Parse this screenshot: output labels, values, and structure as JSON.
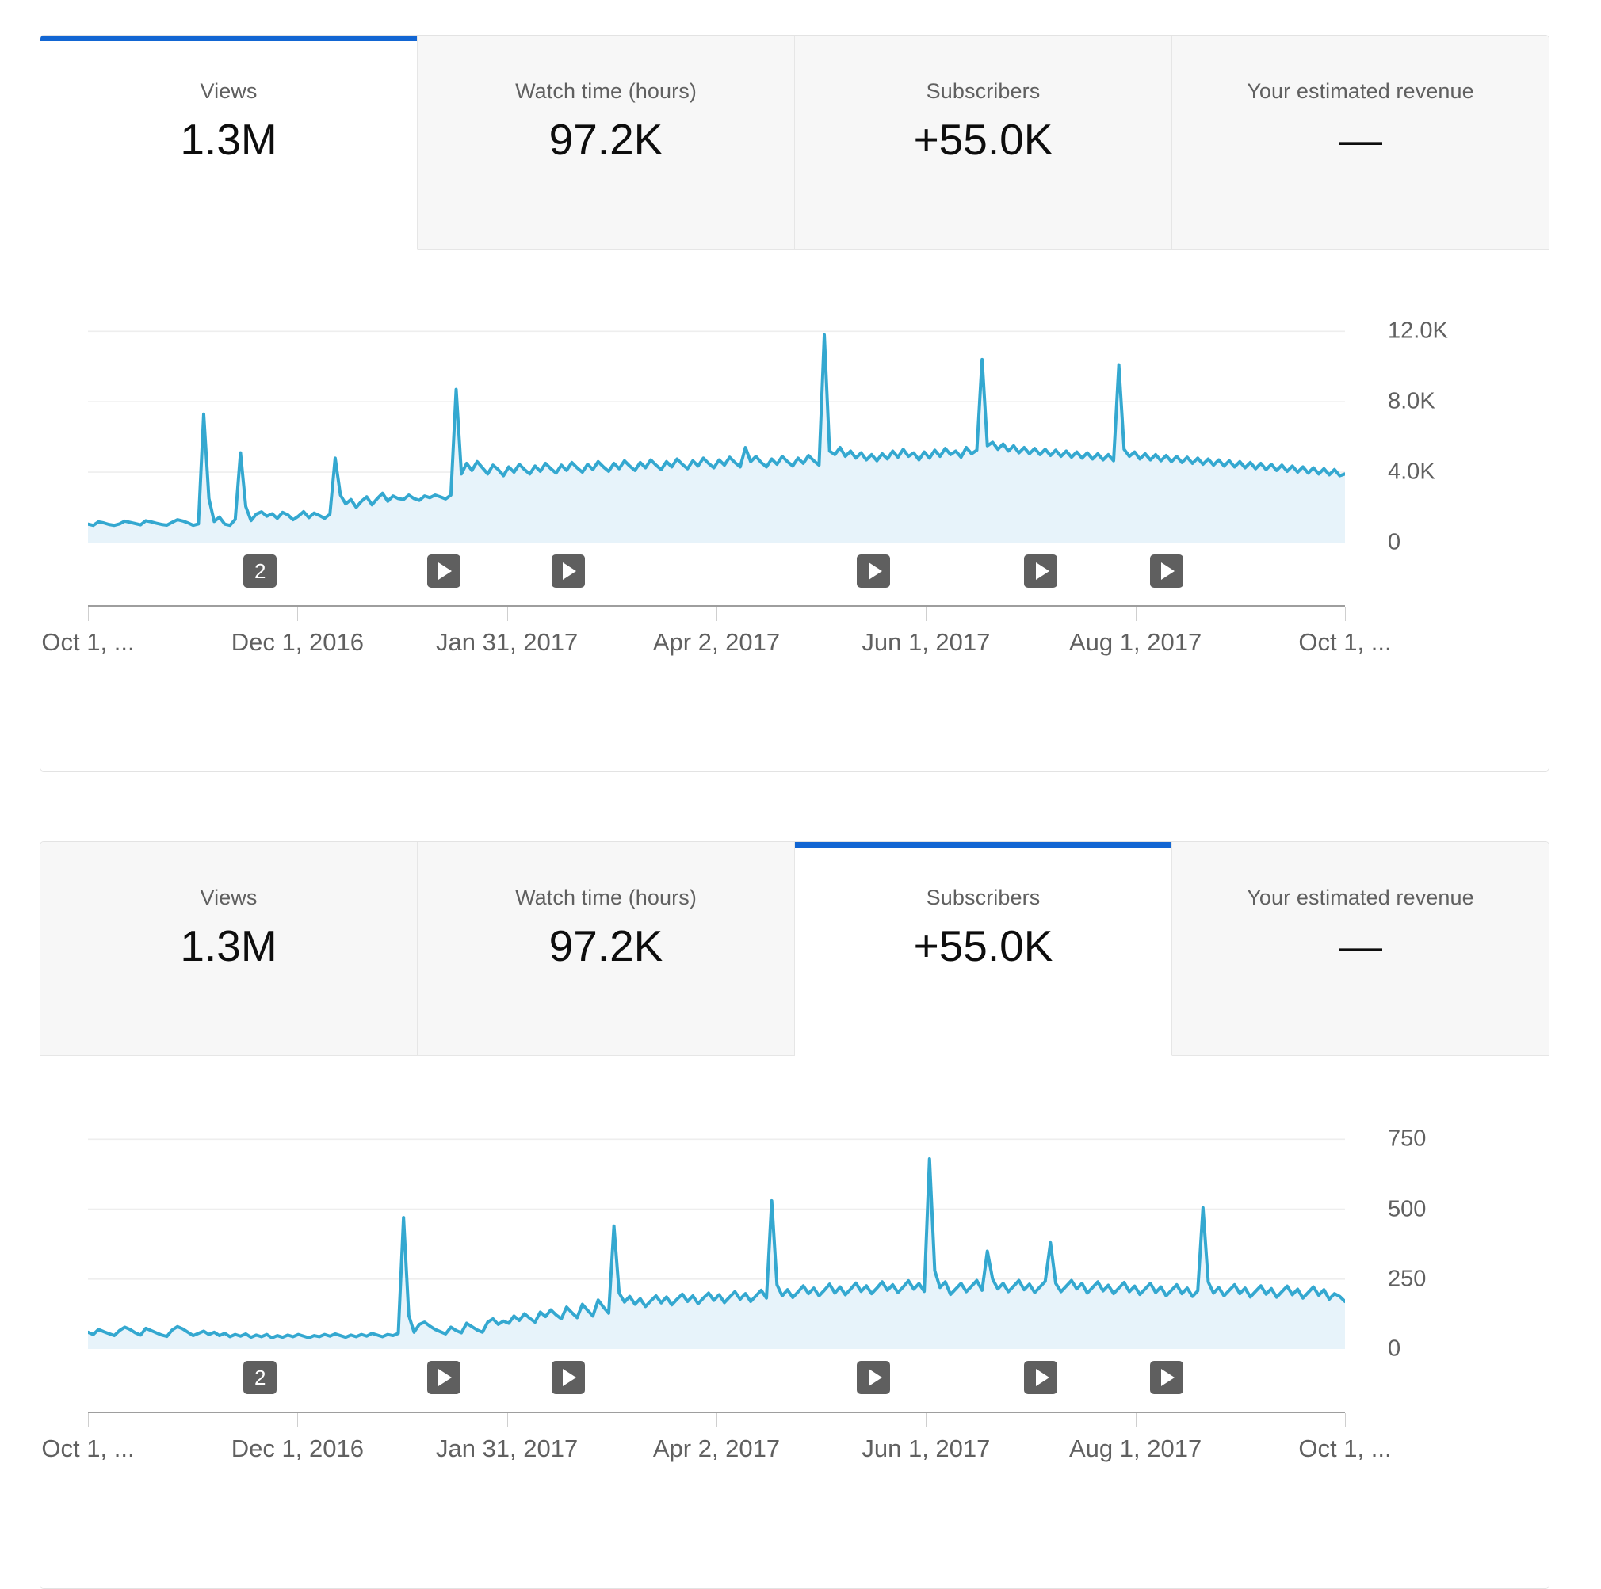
{
  "panels": [
    {
      "name": "views-panel",
      "active_tab_index": 0,
      "tabs": [
        {
          "label": "Views",
          "value": "1.3M",
          "key": "views"
        },
        {
          "label": "Watch time (hours)",
          "value": "97.2K",
          "key": "watch-time"
        },
        {
          "label": "Subscribers",
          "value": "+55.0K",
          "key": "subscribers"
        },
        {
          "label": "Your estimated revenue",
          "value": "—",
          "key": "estimated-revenue"
        }
      ],
      "chart_ref": 0
    },
    {
      "name": "subscribers-panel",
      "active_tab_index": 2,
      "tabs": [
        {
          "label": "Views",
          "value": "1.3M",
          "key": "views"
        },
        {
          "label": "Watch time (hours)",
          "value": "97.2K",
          "key": "watch-time"
        },
        {
          "label": "Subscribers",
          "value": "+55.0K",
          "key": "subscribers"
        },
        {
          "label": "Your estimated revenue",
          "value": "—",
          "key": "estimated-revenue"
        }
      ],
      "chart_ref": 1
    }
  ],
  "colors": {
    "accent_tab": "#1266d3",
    "line": "#34a8d0",
    "area_fill": "#e7f3fa",
    "grid": "#eeeeee",
    "axis": "#9e9e9e",
    "marker": "#5f5f5f",
    "tab_inactive_bg": "#f7f7f7",
    "tab_active_bg": "#ffffff",
    "label_text": "#606060",
    "value_text": "#0d0d0d"
  },
  "video_markers": [
    {
      "label": "2",
      "type": "count",
      "pos": 0.137
    },
    {
      "label": "",
      "type": "play",
      "pos": 0.283
    },
    {
      "label": "",
      "type": "play",
      "pos": 0.382
    },
    {
      "label": "",
      "type": "play",
      "pos": 0.625
    },
    {
      "label": "",
      "type": "play",
      "pos": 0.758
    },
    {
      "label": "",
      "type": "play",
      "pos": 0.858
    }
  ],
  "chart_data": [
    {
      "type": "area",
      "title": "Views",
      "xlabel": "",
      "ylabel": "Views",
      "grid": true,
      "legend": "none",
      "ylim": [
        0,
        13500
      ],
      "yticks": [
        0,
        4000,
        8000,
        12000
      ],
      "ytick_labels": [
        "0",
        "4.0K",
        "8.0K",
        "12.0K"
      ],
      "xticks": [
        0,
        0.1667,
        0.3333,
        0.5,
        0.6667,
        0.8333,
        1.0
      ],
      "xtick_labels": [
        "Oct 1, ...",
        "Dec 1, 2016",
        "Jan 31, 2017",
        "Apr 2, 2017",
        "Jun 1, 2017",
        "Aug 1, 2017",
        "Oct 1, ..."
      ],
      "values": [
        1050,
        980,
        1180,
        1120,
        1030,
        980,
        1060,
        1220,
        1150,
        1080,
        1010,
        1240,
        1180,
        1100,
        1030,
        990,
        1150,
        1300,
        1230,
        1120,
        980,
        1060,
        7300,
        2500,
        1200,
        1450,
        1050,
        980,
        1320,
        5100,
        2050,
        1250,
        1620,
        1750,
        1500,
        1640,
        1380,
        1720,
        1580,
        1300,
        1500,
        1760,
        1420,
        1680,
        1540,
        1380,
        1620,
        4800,
        2700,
        2200,
        2450,
        2000,
        2350,
        2600,
        2150,
        2500,
        2800,
        2350,
        2650,
        2500,
        2450,
        2700,
        2500,
        2400,
        2650,
        2550,
        2700,
        2600,
        2480,
        2700,
        8700,
        3900,
        4500,
        4100,
        4600,
        4250,
        3900,
        4400,
        4150,
        3800,
        4300,
        4000,
        4450,
        4150,
        3900,
        4350,
        4050,
        4500,
        4200,
        3950,
        4400,
        4100,
        4550,
        4250,
        4000,
        4450,
        4150,
        4600,
        4300,
        4050,
        4500,
        4200,
        4650,
        4350,
        4100,
        4550,
        4250,
        4700,
        4400,
        4150,
        4600,
        4300,
        4750,
        4450,
        4200,
        4650,
        4350,
        4800,
        4500,
        4250,
        4700,
        4400,
        4850,
        4550,
        4300,
        5400,
        4600,
        4900,
        4550,
        4300,
        4750,
        4450,
        4900,
        4600,
        4350,
        4800,
        4500,
        4950,
        4650,
        4400,
        11800,
        5200,
        5000,
        5400,
        4900,
        5200,
        4800,
        5100,
        4700,
        5000,
        4650,
        5050,
        4750,
        5200,
        4850,
        5300,
        4900,
        5100,
        4700,
        5150,
        4800,
        5250,
        4900,
        5350,
        5000,
        5200,
        4850,
        5400,
        5050,
        5250,
        10400,
        5500,
        5700,
        5300,
        5600,
        5200,
        5500,
        5100,
        5400,
        5050,
        5350,
        5000,
        5300,
        4950,
        5250,
        4900,
        5200,
        4850,
        5150,
        4800,
        5100,
        4750,
        5050,
        4700,
        5000,
        4650,
        10100,
        5300,
        4900,
        5150,
        4750,
        5050,
        4700,
        5000,
        4650,
        4950,
        4600,
        4900,
        4550,
        4850,
        4500,
        4800,
        4450,
        4750,
        4400,
        4700,
        4350,
        4650,
        4300,
        4600,
        4250,
        4550,
        4200,
        4500,
        4150,
        4450,
        4100,
        4400,
        4050,
        4350,
        4000,
        4300,
        3950,
        4250,
        3900,
        4200,
        3850,
        4150,
        3800,
        3900
      ]
    },
    {
      "type": "area",
      "title": "Subscribers",
      "xlabel": "",
      "ylabel": "Subscribers",
      "grid": true,
      "legend": "none",
      "ylim": [
        0,
        850
      ],
      "yticks": [
        0,
        250,
        500,
        750
      ],
      "ytick_labels": [
        "0",
        "250",
        "500",
        "750"
      ],
      "xticks": [
        0,
        0.1667,
        0.3333,
        0.5,
        0.6667,
        0.8333,
        1.0
      ],
      "xtick_labels": [
        "Oct 1, ...",
        "Dec 1, 2016",
        "Jan 31, 2017",
        "Apr 2, 2017",
        "Jun 1, 2017",
        "Aug 1, 2017",
        "Oct 1, ..."
      ],
      "values": [
        60,
        52,
        70,
        62,
        55,
        48,
        66,
        78,
        70,
        58,
        50,
        74,
        66,
        58,
        50,
        45,
        68,
        80,
        72,
        60,
        48,
        56,
        64,
        52,
        60,
        48,
        56,
        44,
        52,
        46,
        54,
        42,
        50,
        44,
        52,
        40,
        48,
        42,
        50,
        44,
        52,
        46,
        40,
        48,
        44,
        52,
        46,
        54,
        48,
        42,
        50,
        44,
        52,
        46,
        56,
        50,
        44,
        52,
        48,
        56,
        470,
        120,
        60,
        88,
        96,
        82,
        70,
        62,
        54,
        78,
        66,
        58,
        92,
        80,
        68,
        60,
        96,
        108,
        88,
        100,
        92,
        118,
        102,
        126,
        110,
        96,
        132,
        116,
        140,
        122,
        108,
        150,
        130,
        112,
        160,
        138,
        118,
        175,
        150,
        128,
        440,
        200,
        168,
        188,
        160,
        180,
        152,
        172,
        190,
        165,
        186,
        158,
        178,
        196,
        170,
        190,
        162,
        182,
        200,
        174,
        194,
        166,
        186,
        205,
        178,
        198,
        170,
        190,
        210,
        182,
        530,
        230,
        190,
        212,
        184,
        204,
        226,
        198,
        218,
        190,
        210,
        232,
        200,
        222,
        194,
        214,
        236,
        206,
        226,
        198,
        218,
        240,
        210,
        230,
        202,
        222,
        244,
        214,
        234,
        206,
        680,
        280,
        220,
        240,
        195,
        215,
        235,
        205,
        225,
        245,
        210,
        350,
        250,
        215,
        235,
        205,
        225,
        245,
        212,
        232,
        202,
        222,
        242,
        380,
        235,
        205,
        225,
        245,
        215,
        235,
        200,
        220,
        240,
        208,
        228,
        198,
        218,
        238,
        205,
        225,
        195,
        215,
        235,
        202,
        222,
        190,
        210,
        230,
        198,
        218,
        188,
        208,
        505,
        240,
        200,
        220,
        190,
        210,
        230,
        198,
        218,
        186,
        206,
        226,
        196,
        216,
        185,
        205,
        225,
        194,
        214,
        182,
        202,
        222,
        192,
        212,
        178,
        198,
        188,
        170
      ]
    }
  ]
}
